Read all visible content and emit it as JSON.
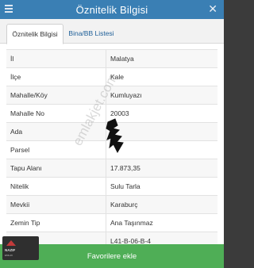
{
  "header": {
    "title": "Öznitelik Bilgisi",
    "close_symbol": "✕"
  },
  "tabs": [
    {
      "label": "Öznitelik Bilgisi",
      "active": true
    },
    {
      "label": "Bina/BB Listesi",
      "active": false
    }
  ],
  "rows": [
    {
      "key": "İl",
      "value": "Malatya"
    },
    {
      "key": "İlçe",
      "value": "Kale"
    },
    {
      "key": "Mahalle/Köy",
      "value": "Kumluyazı"
    },
    {
      "key": "Mahalle No",
      "value": "20003"
    },
    {
      "key": "Ada",
      "value": ""
    },
    {
      "key": "Parsel",
      "value": ""
    },
    {
      "key": "Tapu Alanı",
      "value": "17.873,35"
    },
    {
      "key": "Nitelik",
      "value": "Sulu Tarla"
    },
    {
      "key": "Mevkii",
      "value": "Karaburç"
    },
    {
      "key": "Zemin Tip",
      "value": "Ana Taşınmaz"
    },
    {
      "key": "Pafta",
      "value": "L41-B-06-B-4"
    }
  ],
  "footer": {
    "favorite_label": "Favorilere ekle"
  },
  "overlay": {
    "watermark_text": "emlakjet.com",
    "logo_text": "NAZIF",
    "logo_subtext": "EMLAK",
    "stroke_color": "#111111"
  },
  "colors": {
    "title_bar": "#3a7fb4",
    "favorite_button": "#4fae56",
    "tab_text": "#1e5f98"
  }
}
